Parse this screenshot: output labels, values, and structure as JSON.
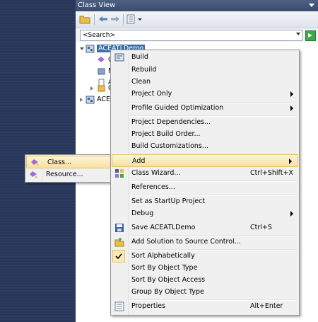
{
  "window": {
    "title": "Class View"
  },
  "search": {
    "text": "<Search>"
  },
  "tree": {
    "root_label": "ACEATLDemo",
    "child_labels": [
      "C",
      "M",
      "A",
      "C"
    ],
    "second_root_label": "ACE"
  },
  "context_menu": {
    "items": [
      {
        "label": "Build",
        "icon": "build-icon"
      },
      {
        "label": "Rebuild"
      },
      {
        "label": "Clean"
      },
      {
        "label": "Project Only",
        "submenu": true
      },
      {
        "label": "Profile Guided Optimization",
        "submenu": true
      },
      {
        "label": "Project Dependencies..."
      },
      {
        "label": "Project Build Order..."
      },
      {
        "label": "Build Customizations..."
      },
      {
        "label": "Add",
        "submenu": true,
        "highlighted": true
      },
      {
        "label": "Class Wizard...",
        "shortcut": "Ctrl+Shift+X",
        "icon": "class-wizard-icon"
      },
      {
        "label": "References..."
      },
      {
        "label": "Set as StartUp Project"
      },
      {
        "label": "Debug",
        "submenu": true
      },
      {
        "label": "Save ACEATLDemo",
        "shortcut": "Ctrl+S",
        "icon": "save-icon"
      },
      {
        "label": "Add Solution to Source Control...",
        "icon": "source-control-icon"
      },
      {
        "label": "Sort Alphabetically",
        "checked": true
      },
      {
        "label": "Sort By Object Type"
      },
      {
        "label": "Sort By Object Access"
      },
      {
        "label": "Group By Object Type"
      },
      {
        "label": "Properties",
        "shortcut": "Alt+Enter",
        "icon": "properties-icon"
      }
    ]
  },
  "submenu": {
    "items": [
      {
        "label": "Class...",
        "highlighted": true,
        "icon": "class-icon"
      },
      {
        "label": "Resource...",
        "icon": "resource-icon"
      }
    ]
  },
  "colors": {
    "highlight": "#f8e0a2",
    "selection": "#3a6ea5",
    "titlebar": "#4d6082",
    "background": "#2b3c59"
  }
}
